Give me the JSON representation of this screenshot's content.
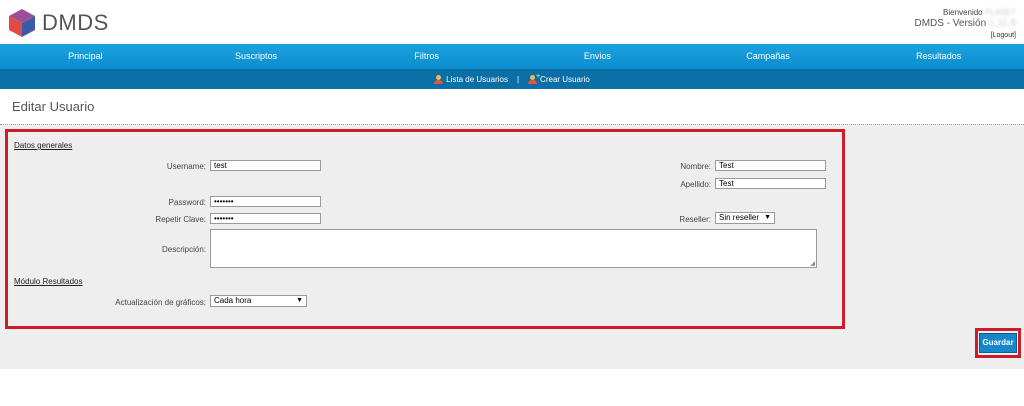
{
  "header": {
    "brand": "DMDS",
    "welcome_label": "Bienvenido",
    "welcome_user": "PLANET",
    "version_label": "DMDS - Versión",
    "version_value": "1.11.9",
    "logout_label": "[Logout]"
  },
  "nav": {
    "items": [
      "Principal",
      "Suscriptos",
      "Filtros",
      "Envios",
      "Campañas",
      "Resultados"
    ]
  },
  "subnav": {
    "list_users": "Lista de Usuarios",
    "separator": "|",
    "create_user": "Crear Usuario"
  },
  "page": {
    "title": "Editar Usuario"
  },
  "form": {
    "general_section": "Datos generales",
    "username_label": "Username:",
    "username_value": "test",
    "password_label": "Password:",
    "password_value": "•••••••",
    "repeat_label": "Repetir Clave:",
    "repeat_value": "•••••••",
    "description_label": "Descripción:",
    "nombre_label": "Nombre:",
    "nombre_value": "Test",
    "apellido_label": "Apellido:",
    "apellido_value": "Test",
    "reseller_label": "Reseller:",
    "reseller_value": "Sin reseller",
    "results_section": "Módulo Resultados",
    "update_label": "Actualización de gráficos:",
    "update_value": "Cada hora",
    "save_button": "Guardar"
  },
  "colors": {
    "nav": "#1a9ad9",
    "subnav": "#0a6fa6",
    "highlight": "#cc1e2a",
    "button": "#1787c9"
  }
}
